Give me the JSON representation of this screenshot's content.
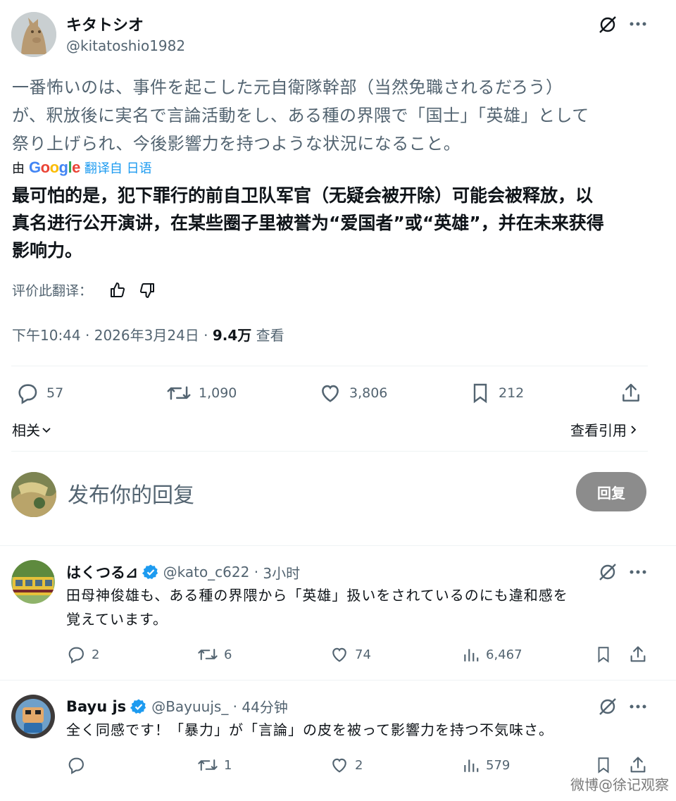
{
  "tweet": {
    "author_name": "キタトシオ",
    "author_handle": "@kitatoshio1982",
    "original_lines": [
      "一番怖いのは、事件を起こした元自衛隊幹部（当然免職されるだろう）",
      "が、釈放後に実名で言論活動をし、ある種の界隈で「国士」「英雄」として",
      "祭り上げられ、今後影響力を持つような状況になること。"
    ],
    "translated_by_prefix": "由",
    "translated_by_brand": "Google",
    "translated_by_suffix": "翻译自 日语",
    "translation_lines": [
      "最可怕的是，犯下罪行的前自卫队军官（无疑会被开除）可能会被释放，以",
      "真名进行公开演讲，在某些圈子里被誉为“爱国者”或“英雄”，并在未来获得",
      "影响力。"
    ],
    "rate_label": "评价此翻译：",
    "time": "下午10:44",
    "date": "2026年3月24日",
    "views_count": "9.4万",
    "views_label": "查看",
    "stats": {
      "replies": "57",
      "retweets": "1,090",
      "likes": "3,806",
      "bookmarks": "212"
    },
    "related_label": "相关",
    "quotes_label": "查看引用"
  },
  "composer": {
    "placeholder": "发布你的回复",
    "button_label": "回复"
  },
  "replies": [
    {
      "name": "はくつる⊿",
      "handle": "@kato_c622",
      "time": "3小时",
      "lines": [
        "田母神俊雄も、ある種の界隈から「英雄」扱いをされているのにも違和感を",
        "覚えています。"
      ],
      "replies": "2",
      "retweets": "6",
      "likes": "74",
      "views": "6,467"
    },
    {
      "name": "Bayu js",
      "handle": "@Bayuujs_",
      "time": "44分钟",
      "lines": [
        "全く同感です！「暴力」が「言論」の皮を被って影響力を持つ不気味さ。"
      ],
      "replies": "",
      "retweets": "1",
      "likes": "2",
      "views": "579"
    }
  ],
  "watermark": "微博@徐记观察",
  "colors": {
    "accent": "#1d9bf0",
    "muted": "#536471",
    "button": "#8c8c8c"
  }
}
